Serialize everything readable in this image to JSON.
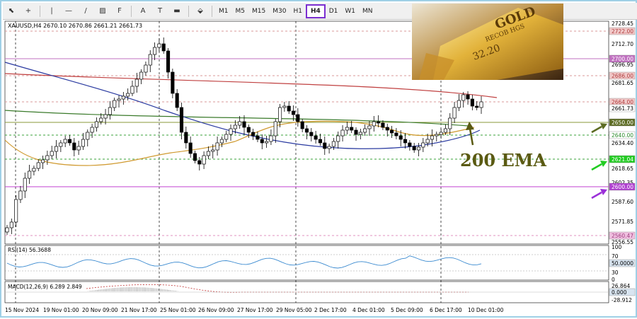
{
  "toolbar": {
    "tools": [
      {
        "name": "cursor-icon",
        "glyph": "⬉"
      },
      {
        "name": "crosshair-icon",
        "glyph": "+"
      },
      {
        "name": "vertical-line-icon",
        "glyph": "|"
      },
      {
        "name": "horizontal-line-icon",
        "glyph": "—"
      },
      {
        "name": "trendline-icon",
        "glyph": "/"
      },
      {
        "name": "channel-icon",
        "glyph": "▨"
      },
      {
        "name": "fibonacci-icon",
        "glyph": "F"
      },
      {
        "name": "text-icon",
        "glyph": "A"
      },
      {
        "name": "text-label-icon",
        "glyph": "T"
      },
      {
        "name": "rectangle-label-icon",
        "glyph": "▬"
      },
      {
        "name": "shapes-icon",
        "glyph": "⬙"
      }
    ],
    "timeframes": [
      "M1",
      "M5",
      "M15",
      "M30",
      "H1",
      "H4",
      "D1",
      "W1",
      "MN"
    ],
    "active_timeframe": "H4"
  },
  "chart": {
    "symbol_line": "XAUUSD,H4  2670.10 2670.86 2661.21 2661.73",
    "rsi_label": "RSI(14) 56.3688",
    "macd_label": "MACD(12,26,9) 6.289 2.849",
    "annotation": "200 EMA",
    "price_axis": [
      "2728.45",
      "2712.70",
      "2696.95",
      "2681.65",
      "2634.40",
      "2618.65",
      "2602.35",
      "2587.60",
      "2571.85",
      "2556.55"
    ],
    "price_tags": [
      {
        "value": "2722.00",
        "bg": "#f1c8c8",
        "fg": "#b04040"
      },
      {
        "value": "2700.00",
        "bg": "#c070c0",
        "fg": "#ffffff"
      },
      {
        "value": "2686.00",
        "bg": "#f1c8c8",
        "fg": "#b04040"
      },
      {
        "value": "2664.00",
        "bg": "#f1c8c8",
        "fg": "#b04040"
      },
      {
        "value": "2661.73",
        "bg": "#ffffff",
        "fg": "#000000"
      },
      {
        "value": "2650.00",
        "bg": "#5c6b22",
        "fg": "#ffffff"
      },
      {
        "value": "2640.00",
        "bg": "#ffffff",
        "fg": "#2a8a2a"
      },
      {
        "value": "2621.04",
        "bg": "#22cc22",
        "fg": "#ffffff"
      },
      {
        "value": "2600.00",
        "bg": "#b040d0",
        "fg": "#ffffff"
      },
      {
        "value": "2560.47",
        "bg": "#f0c0e0",
        "fg": "#a04080"
      }
    ],
    "rsi_axis": [
      "100",
      "70",
      "50.0000",
      "30",
      "0"
    ],
    "macd_axis": [
      "26.864",
      "0.000",
      "-28.912"
    ],
    "time_axis": [
      "15 Nov 2024",
      "19 Nov 01:00",
      "20 Nov 09:00",
      "21 Nov 17:00",
      "25 Nov 01:00",
      "26 Nov 09:00",
      "27 Nov 17:00",
      "29 Nov 05:00",
      "2 Dec 17:00",
      "4 Dec 01:00",
      "5 Dec 09:00",
      "6 Dec 17:00",
      "10 Dec 01:00"
    ],
    "gold_bar_text": [
      "GOLD",
      "RECOB HGS",
      "32.20"
    ],
    "colors": {
      "bull": "#000000",
      "ema_red": "#c04040",
      "ema_green": "#3a7a2a",
      "ema_blue": "#2a3aa0",
      "ema_orange": "#d09a30",
      "annotation": "#5a5a12",
      "arrow_olive": "#5c6b22",
      "arrow_green": "#22cc22",
      "arrow_purple": "#9b30d8"
    }
  }
}
